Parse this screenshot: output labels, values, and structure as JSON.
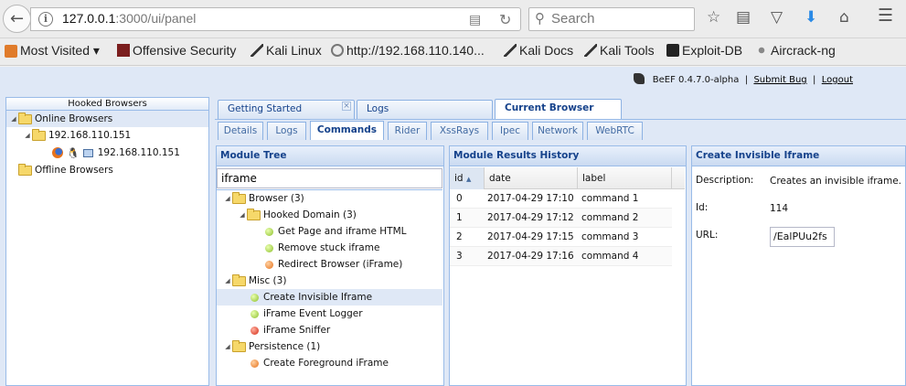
{
  "browser": {
    "url_host": "127.0.0.1",
    "url_rest": ":3000/ui/panel",
    "search_placeholder": "Search",
    "bookmarks": [
      "Most Visited ▾",
      "Offensive Security",
      "Kali Linux",
      "http://192.168.110.140...",
      "Kali Docs",
      "Kali Tools",
      "Exploit-DB",
      "Aircrack-ng"
    ]
  },
  "header": {
    "version": "BeEF  0.4.7.0-alpha",
    "separator": "|",
    "submit_bug": "Submit  Bug",
    "logout": "Logout"
  },
  "hooked_browsers": {
    "title": "Hooked Browsers",
    "online_label": "Online Browsers",
    "host": "192.168.110.151",
    "browser_ip": "192.168.110.151",
    "offline_label": "Offline Browsers"
  },
  "main_tabs": [
    {
      "label": "Getting Started"
    },
    {
      "label": "Logs"
    },
    {
      "label": "Current Browser"
    }
  ],
  "sub_tabs": [
    "Details",
    "Logs",
    "Commands",
    "Rider",
    "XssRays",
    "Ipec",
    "Network",
    "WebRTC"
  ],
  "module_tree": {
    "title": "Module Tree",
    "filter_value": "iframe",
    "browser_label": "Browser (3)",
    "hooked_domain_label": "Hooked Domain (3)",
    "mod_get_page": "Get Page and iframe HTML",
    "mod_remove_stuck": "Remove stuck iframe",
    "mod_redirect": "Redirect Browser (iFrame)",
    "misc_label": "Misc (3)",
    "mod_create_invisible": "Create Invisible Iframe",
    "mod_event_logger": "iFrame Event Logger",
    "mod_sniffer": "iFrame Sniffer",
    "persistence_label": "Persistence (1)",
    "mod_create_foreground": "Create Foreground iFrame"
  },
  "results": {
    "title": "Module Results History",
    "columns": [
      "id",
      "date",
      "label"
    ],
    "rows": [
      {
        "id": "0",
        "date": "2017-04-29 17:10",
        "label": "command 1"
      },
      {
        "id": "1",
        "date": "2017-04-29 17:12",
        "label": "command 2"
      },
      {
        "id": "2",
        "date": "2017-04-29 17:15",
        "label": "command 3"
      },
      {
        "id": "3",
        "date": "2017-04-29 17:16",
        "label": "command 4"
      }
    ]
  },
  "details": {
    "title": "Create Invisible Iframe",
    "description_label": "Description:",
    "description": "Creates an invisible iframe.",
    "id_label": "Id:",
    "id": "114",
    "url_label": "URL:",
    "url_value": "/EalPUu2fs"
  }
}
